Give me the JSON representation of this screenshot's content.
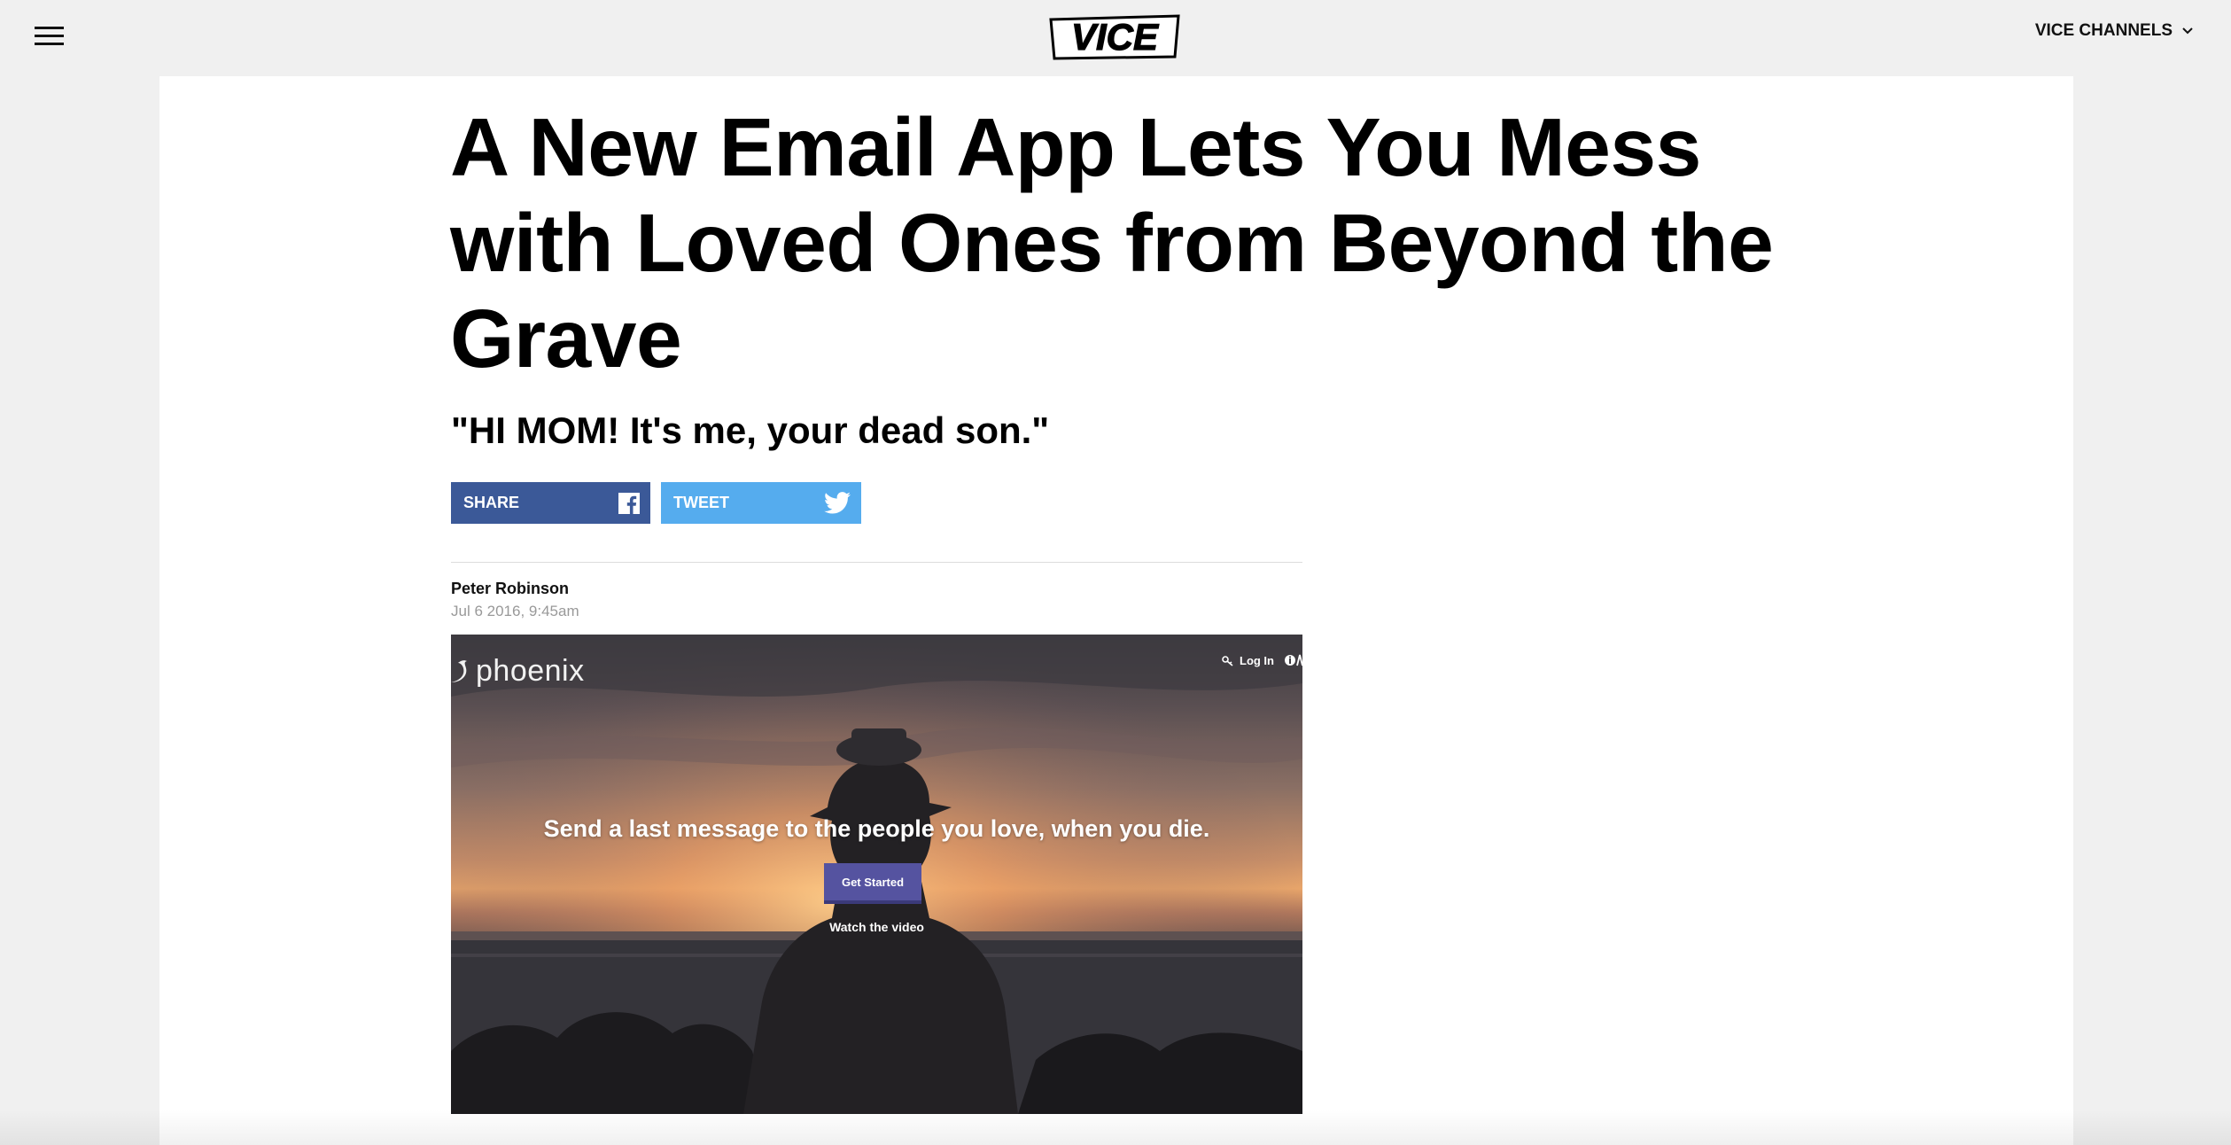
{
  "header": {
    "logo_text": "VICE",
    "channels_label": "VICE CHANNELS",
    "icons": {
      "menu": "hamburger-menu-icon",
      "channels_dropdown": "chevron-down-icon"
    }
  },
  "article": {
    "headline": "A New Email App Lets You Mess with Loved Ones from Beyond the Grave",
    "dek": "\"HI MOM! It's me, your dead son.\"",
    "share": {
      "facebook_label": "SHARE",
      "twitter_label": "TWEET",
      "facebook_color": "#3b5998",
      "twitter_color": "#55acee"
    },
    "author": "Peter Robinson",
    "date": "Jul 6 2016, 9:45am"
  },
  "hero_image": {
    "brand": "phoenix",
    "login_label": "Log In",
    "headline": "Send a last message to the people you love, when you die.",
    "cta_label": "Get Started",
    "video_link": "Watch the video",
    "cta_color": "#5553a0"
  }
}
